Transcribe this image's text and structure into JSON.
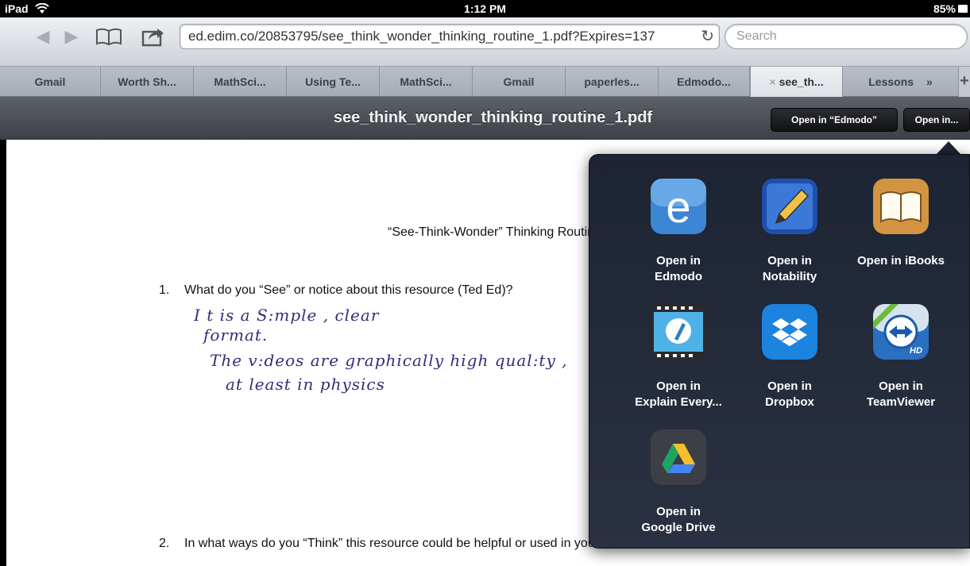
{
  "status": {
    "carrier": "iPad",
    "time": "1:12 PM",
    "battery": "85%"
  },
  "toolbar": {
    "url": "ed.edim.co/20853795/see_think_wonder_thinking_routine_1.pdf?Expires=137",
    "search_placeholder": "Search"
  },
  "tabs": [
    {
      "label": "Gmail"
    },
    {
      "label": "Worth Sh..."
    },
    {
      "label": "MathSci..."
    },
    {
      "label": "Using Te..."
    },
    {
      "label": "MathSci..."
    },
    {
      "label": "Gmail"
    },
    {
      "label": "paperles..."
    },
    {
      "label": "Edmodo..."
    },
    {
      "label": "see_th...",
      "active": true,
      "close": "×"
    },
    {
      "label": "Lessons",
      "overflow": "»"
    }
  ],
  "pdf": {
    "title": "see_think_wonder_thinking_routine_1.pdf",
    "open_in_edmodo": "Open in “Edmodo”",
    "open_in": "Open in..."
  },
  "document": {
    "heading": "“See-Think-Wonder” Thinking Routine",
    "q1_num": "1.",
    "q1": "What do you “See” or notice about this resource (Ted Ed)?",
    "hand_lines": [
      "I t  is  a  S:mple , clear",
      "format.",
      "The  v:deos  are  graphically  high  qual:ty ,",
      "at  least  in  physics"
    ],
    "q2_num": "2.",
    "q2": "In what ways do you “Think” this resource could be helpful or used in your classroom?"
  },
  "share_menu": {
    "apps": [
      {
        "name": "edmodo-icon",
        "label": "Open in\nEdmodo",
        "color": "#2f6fb5"
      },
      {
        "name": "notability-icon",
        "label": "Open in\nNotability",
        "color": "#2a58b0"
      },
      {
        "name": "ibooks-icon",
        "label": "Open in iBooks",
        "color": "#c98a3b"
      },
      {
        "name": "explain-everything-icon",
        "label": "Open in\nExplain Every...",
        "color": "#3a9bd0"
      },
      {
        "name": "dropbox-icon",
        "label": "Open in\nDropbox",
        "color": "#1a7fd9"
      },
      {
        "name": "teamviewer-icon",
        "label": "Open in\nTeamViewer",
        "color": "#1e64b4"
      },
      {
        "name": "google-drive-icon",
        "label": "Open in\nGoogle Drive",
        "color": "#3a3d44"
      }
    ]
  }
}
